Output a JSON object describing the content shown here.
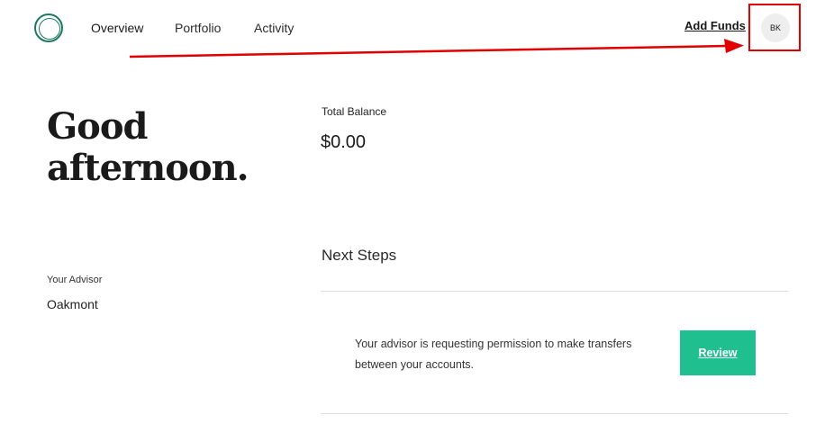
{
  "nav": {
    "items": [
      {
        "label": "Overview",
        "active": true
      },
      {
        "label": "Portfolio",
        "active": false
      },
      {
        "label": "Activity",
        "active": false
      }
    ]
  },
  "header": {
    "add_funds_label": "Add Funds",
    "avatar_initials": "BK"
  },
  "greeting": {
    "line1": "Good",
    "line2": "afternoon."
  },
  "advisor": {
    "label": "Your Advisor",
    "name": "Oakmont"
  },
  "balance": {
    "label": "Total Balance",
    "value": "$0.00"
  },
  "next_steps": {
    "title": "Next Steps",
    "items": [
      {
        "text": "Your advisor is requesting permission to make transfers between your accounts.",
        "button_label": "Review"
      }
    ]
  },
  "colors": {
    "brand": "#1c7a5c",
    "button": "#1fbf8f",
    "annotation": "#e00000"
  }
}
